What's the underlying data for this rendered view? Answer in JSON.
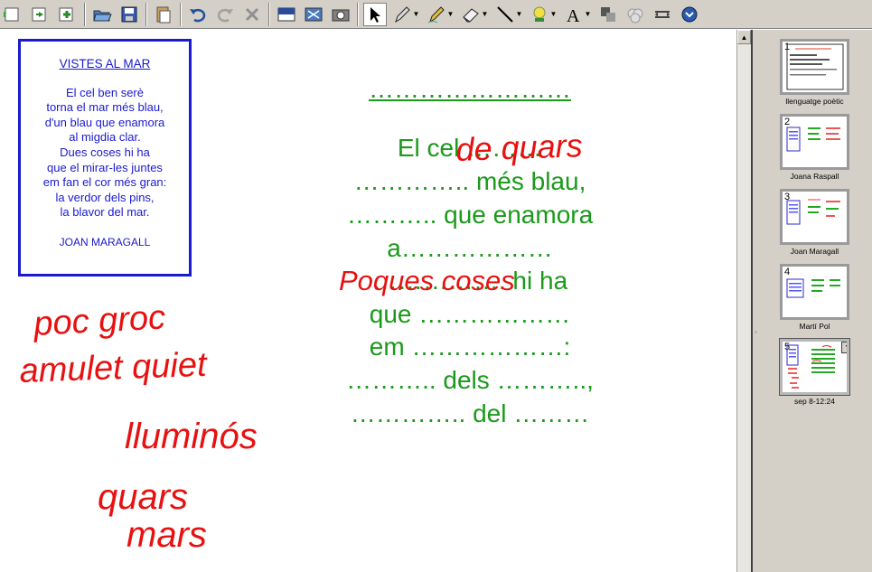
{
  "toolbar": {
    "buttons": [
      {
        "name": "previous-page-icon"
      },
      {
        "name": "next-page-icon"
      },
      {
        "name": "add-page-icon"
      },
      {
        "name": "open-folder-icon"
      },
      {
        "name": "save-icon"
      },
      {
        "name": "paste-icon"
      },
      {
        "name": "undo-icon"
      },
      {
        "name": "redo-icon"
      },
      {
        "name": "delete-icon"
      },
      {
        "name": "screen-shade-icon"
      },
      {
        "name": "full-screen-icon"
      },
      {
        "name": "capture-icon"
      },
      {
        "name": "select-arrow-icon"
      },
      {
        "name": "pen-icon"
      },
      {
        "name": "creative-pen-icon"
      },
      {
        "name": "eraser-icon"
      },
      {
        "name": "line-icon"
      },
      {
        "name": "shapes-icon"
      },
      {
        "name": "text-icon"
      },
      {
        "name": "fill-icon"
      },
      {
        "name": "properties-icon"
      },
      {
        "name": "move-toolbar-icon"
      },
      {
        "name": "more-icon"
      }
    ]
  },
  "poem": {
    "title": "VISTES AL MAR",
    "lines": [
      "El cel ben serè",
      "torna el mar més blau,",
      "d'un blau que enamora",
      "al migdia clar.",
      "Dues coses hi ha",
      "que el mirar-les juntes",
      "em fan el cor més gran:",
      "la verdor dels pins,",
      "la blavor del mar."
    ],
    "author": "JOAN MARAGALL"
  },
  "exercise": {
    "title": "……………………",
    "lines": [
      "El cel ………",
      "………….. més blau,",
      "……….. que enamora",
      "a………………",
      "……………. hi ha",
      "que ………………",
      "em ………………:",
      "……….. dels ………..,",
      "………….. del ………"
    ]
  },
  "handwriting": [
    "de quars",
    "Poques coses",
    "poc groc",
    "amulet quiet",
    "lluminós",
    "quars",
    "mars"
  ],
  "pages": [
    {
      "number": "1",
      "label": "llenguatge poètic"
    },
    {
      "number": "2",
      "label": "Joana Raspall"
    },
    {
      "number": "3",
      "label": "Joan Maragall"
    },
    {
      "number": "4",
      "label": "Martí Pol"
    },
    {
      "number": "5",
      "label": "sep 8-12:24",
      "selected": true
    }
  ],
  "colors": {
    "poem_blue": "#1a1ad0",
    "exercise_green": "#1a9a1a",
    "ink_red": "#e81010",
    "toolbar_gray": "#d4d0c8"
  }
}
